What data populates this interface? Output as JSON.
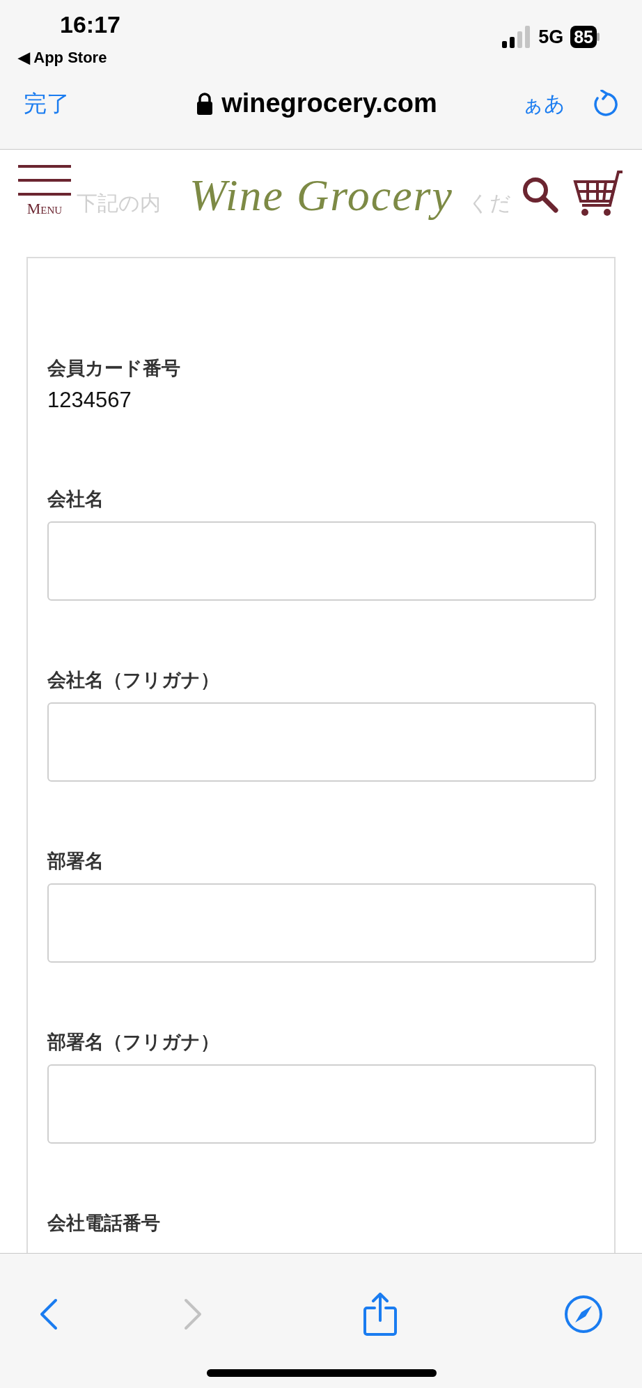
{
  "status_bar": {
    "time": "16:17",
    "back_app": "◀ App Store",
    "network": "5G",
    "battery": "85"
  },
  "browser_bar": {
    "done": "完了",
    "url": "winegrocery.com",
    "text_size": "ぁあ"
  },
  "site_header": {
    "menu_label": "Menu",
    "logo": "Wine Grocery",
    "intro_parts": [
      "下記の内",
      "くだ"
    ]
  },
  "form": [
    {
      "kind": "display",
      "label": "会員カード番号",
      "value": "1234567"
    },
    {
      "kind": "input",
      "label": "会社名"
    },
    {
      "kind": "input",
      "label": "会社名（フリガナ）"
    },
    {
      "kind": "input",
      "label": "部署名"
    },
    {
      "kind": "input",
      "label": "部署名（フリガナ）"
    },
    {
      "kind": "label",
      "label": "会社電話番号"
    }
  ],
  "toolbar": {
    "forward_disabled": true
  }
}
